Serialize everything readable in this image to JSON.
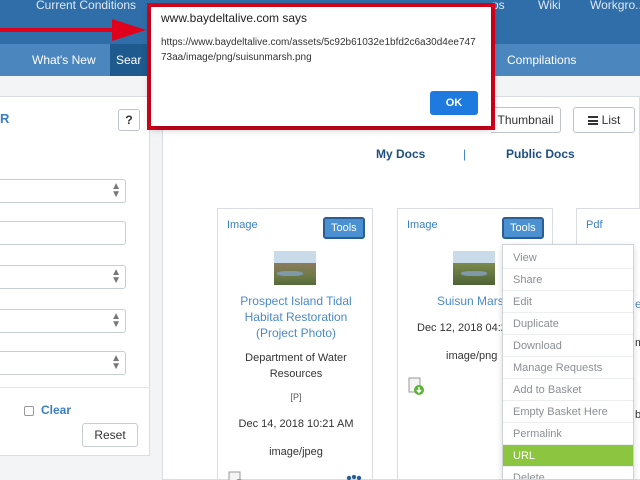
{
  "nav": {
    "top_items": [
      "Current Conditions",
      "...ps",
      "Wiki",
      "Workgro..."
    ],
    "sub_items": [
      {
        "label": "What's New"
      },
      {
        "label": "Sear",
        "active": true
      },
      {
        "label": "Compilations"
      }
    ]
  },
  "left_panel": {
    "heading": "R",
    "help_label": "?",
    "clear_label": "Clear",
    "reset_label": "Reset"
  },
  "main": {
    "thumbnail_label": "Thumbnail",
    "list_label": "List",
    "tabs": {
      "my_docs": "My Docs",
      "separator": "|",
      "public_docs": "Public Docs"
    },
    "cards": [
      {
        "type": "Image",
        "tools_label": "Tools",
        "title": "Prospect Island Tidal Habitat Restoration (Project Photo)",
        "org": "Department of Water Resources",
        "tag": "[P]",
        "date": "Dec 14, 2018 10:21 AM",
        "format": "image/jpeg"
      },
      {
        "type": "Image",
        "tools_label": "Tools",
        "title": "Suisun Mars",
        "date": "Dec 12, 2018 04:2",
        "format": "image/png"
      },
      {
        "type": "Pdf"
      }
    ],
    "third_card_fragments": [
      "e",
      "m",
      "b"
    ],
    "tools_menu": [
      {
        "label": "View"
      },
      {
        "label": "Share"
      },
      {
        "label": "Edit"
      },
      {
        "label": "Duplicate"
      },
      {
        "label": "Download"
      },
      {
        "label": "Manage Requests"
      },
      {
        "label": "Add to Basket"
      },
      {
        "label": "Empty Basket Here"
      },
      {
        "label": "Permalink"
      },
      {
        "label": "URL",
        "active": true
      },
      {
        "label": "Delete"
      }
    ]
  },
  "alert": {
    "title": "www.baydeltalive.com says",
    "message": "https://www.baydeltalive.com/assets/5c92b61032e1bfd2c6a30d4ee74773aa/image/png/suisunmarsh.png",
    "ok_label": "OK"
  },
  "colors": {
    "nav_top": "#2f6ea8",
    "nav_sub": "#4b86bf",
    "link_blue": "#3a7fc4",
    "tools_blue": "#4b90d1",
    "menu_highlight": "#8cc540",
    "alert_outline": "#e0001b",
    "ok_button": "#1f7ae0"
  }
}
